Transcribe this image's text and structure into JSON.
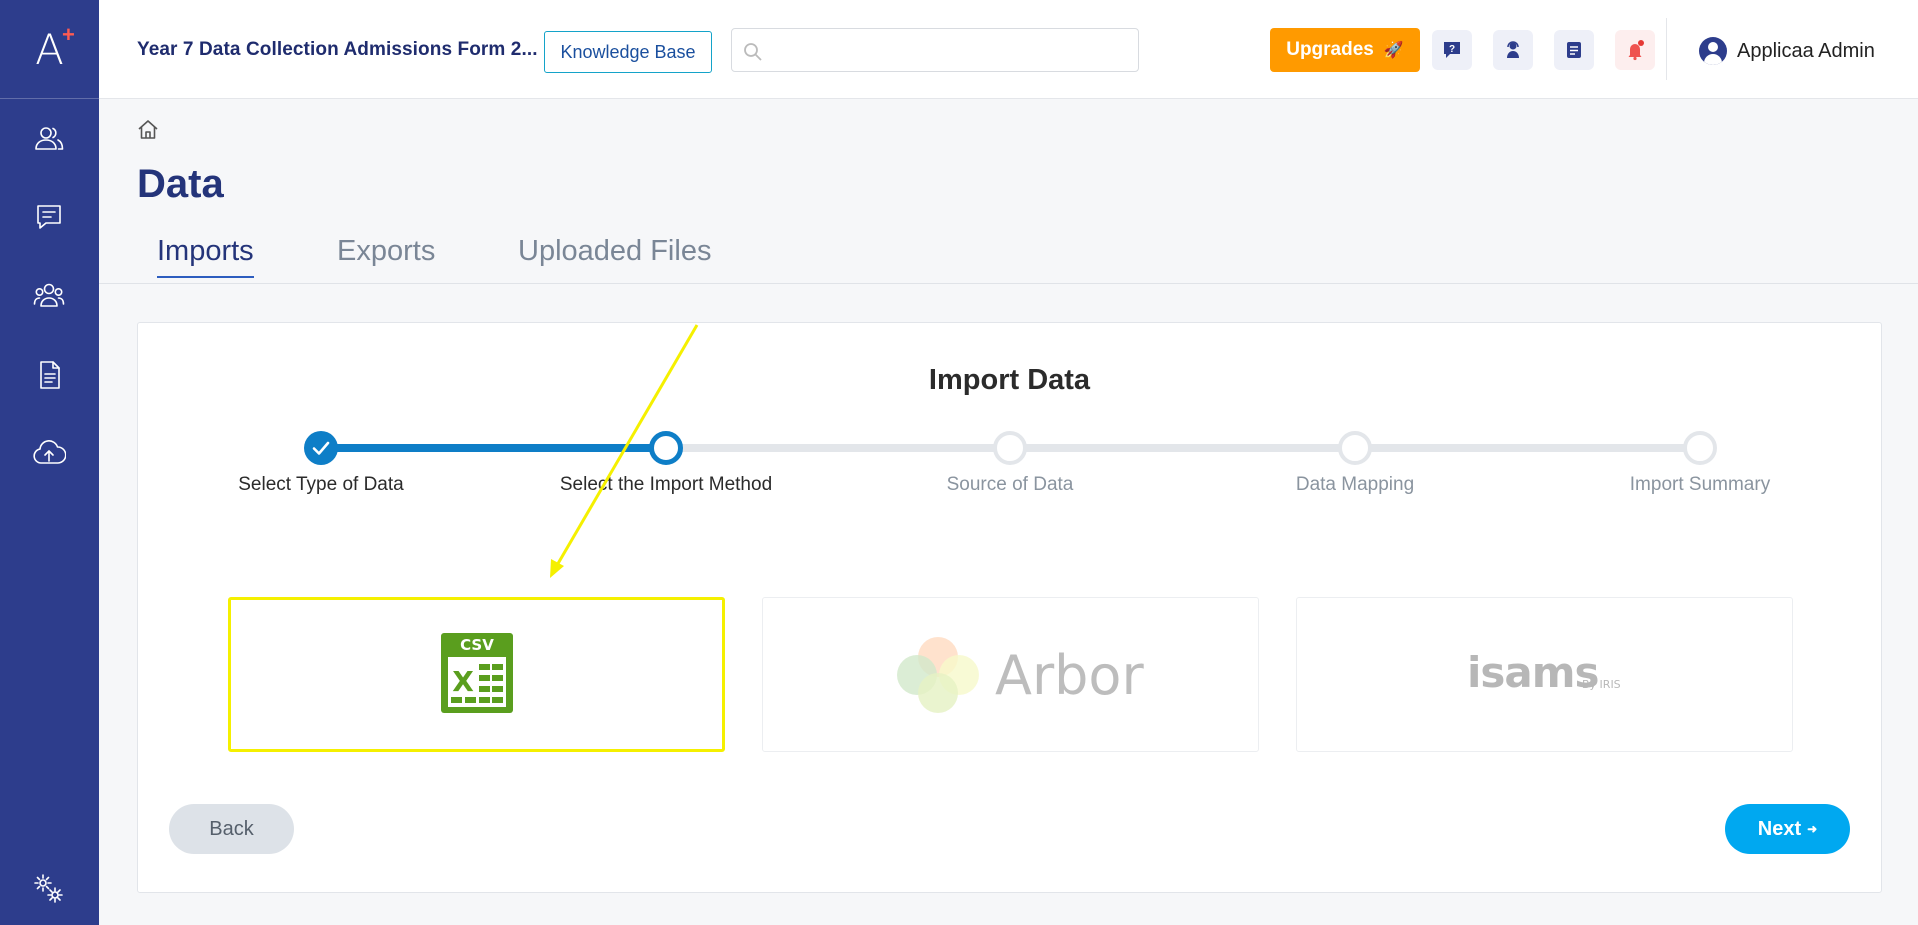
{
  "sidebar": {
    "logo_letter": "A",
    "logo_plus": "+",
    "items": [
      {
        "icon": "user-group-icon"
      },
      {
        "icon": "message-icon"
      },
      {
        "icon": "users-icon"
      },
      {
        "icon": "document-icon"
      },
      {
        "icon": "cloud-upload-icon"
      },
      {
        "icon": "settings-icon"
      }
    ]
  },
  "topbar": {
    "form_title": "Year 7 Data Collection Admissions Form 2...",
    "knowledge_base_label": "Knowledge Base",
    "search_placeholder": "",
    "upgrades_label": "Upgrades",
    "upgrades_emoji": "🚀",
    "user_name": "Applicaa Admin"
  },
  "page": {
    "title": "Data",
    "tabs": [
      {
        "label": "Imports",
        "active": true
      },
      {
        "label": "Exports",
        "active": false
      },
      {
        "label": "Uploaded Files",
        "active": false
      }
    ]
  },
  "import": {
    "title": "Import Data",
    "steps": [
      {
        "label": "Select Type of Data",
        "status": "complete"
      },
      {
        "label": "Select the Import Method",
        "status": "current"
      },
      {
        "label": "Source of Data",
        "status": "pending"
      },
      {
        "label": "Data Mapping",
        "status": "pending"
      },
      {
        "label": "Import Summary",
        "status": "pending"
      }
    ],
    "options": [
      {
        "name": "CSV",
        "badge": "CSV",
        "cells": "X",
        "selected": true
      },
      {
        "name": "Arbor",
        "wordmark": "Arbor",
        "selected": false
      },
      {
        "name": "iSAMS",
        "wordmark": "isams",
        "suffix": "By IRIS",
        "selected": false
      }
    ],
    "back_label": "Back",
    "next_label": "Next",
    "next_arrow": "➜"
  },
  "colors": {
    "sidebar": "#2d3d8c",
    "accent_blue": "#0e7ec7",
    "upgrades": "#ff9a00",
    "next": "#00a8f0",
    "highlight": "#f5f000",
    "csv_green": "#5a9e1e"
  }
}
